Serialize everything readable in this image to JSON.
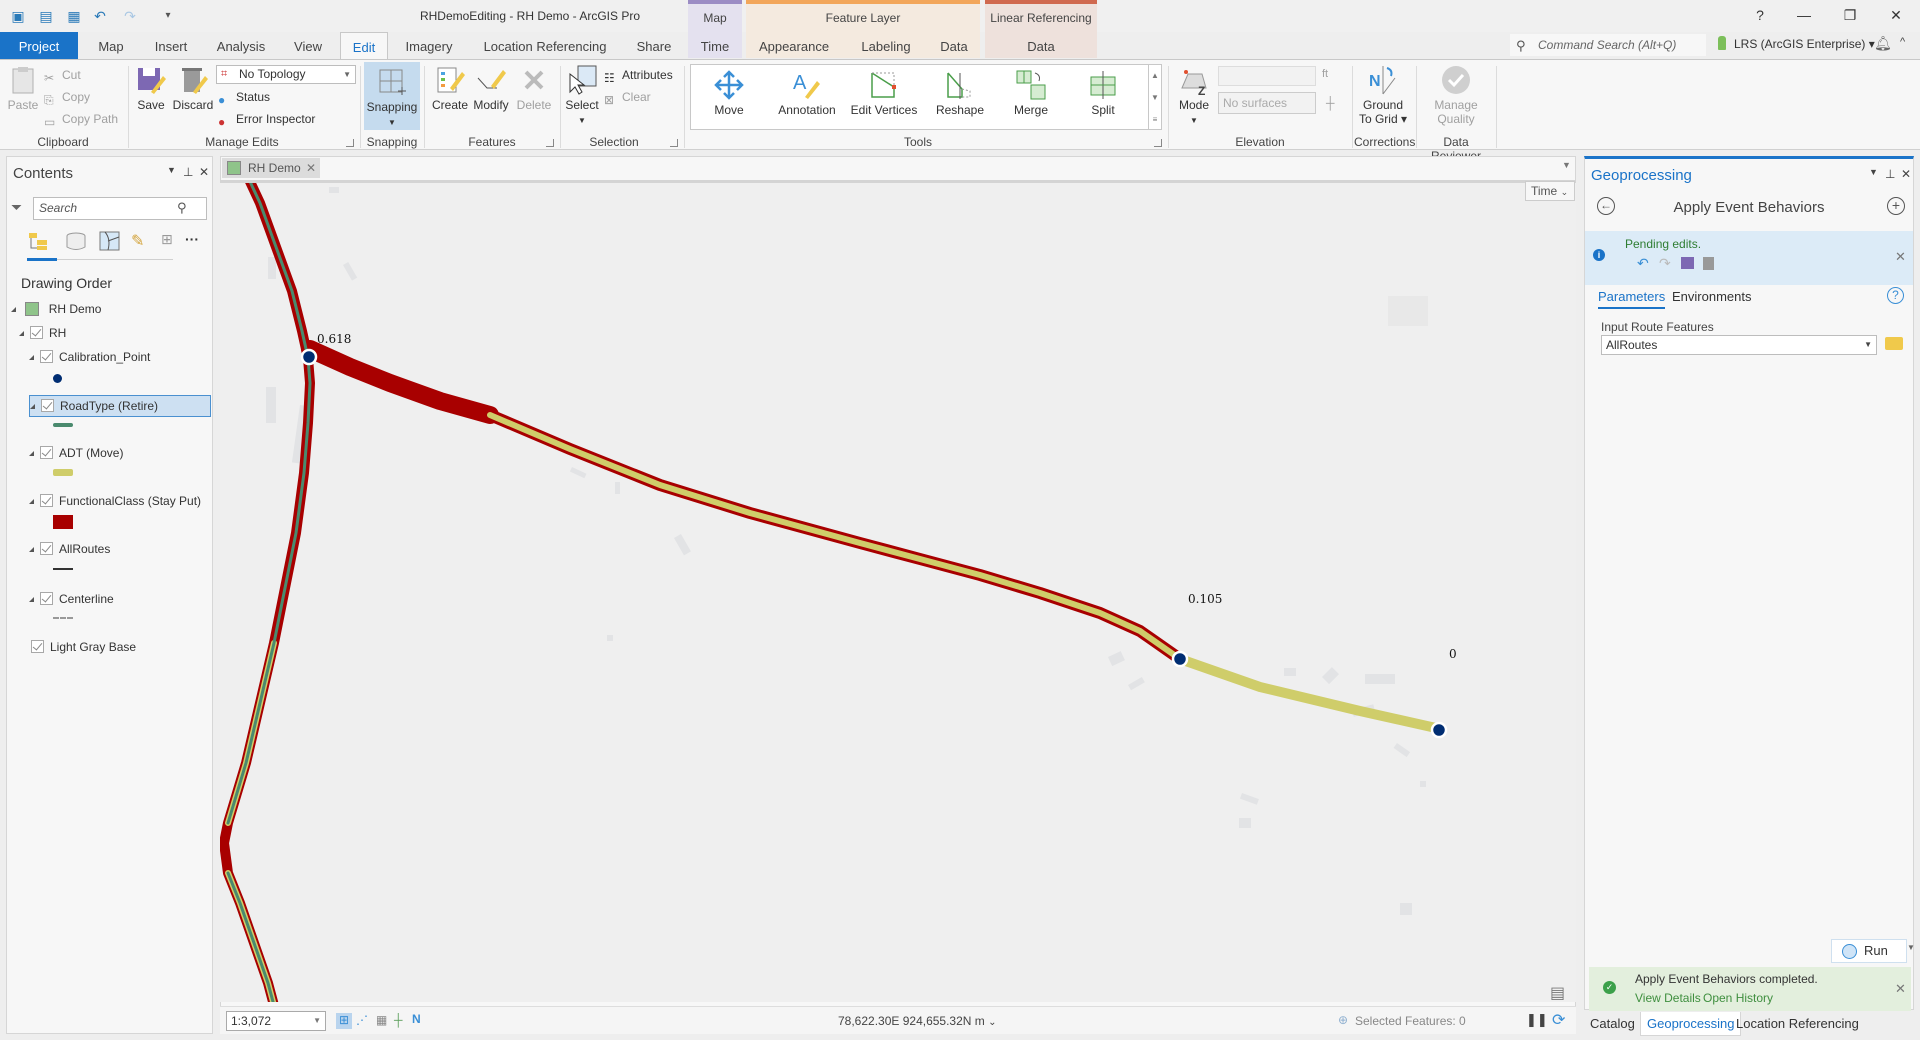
{
  "app": {
    "title": "RHDemoEditing - RH Demo - ArcGIS Pro"
  },
  "quick_access": [
    "new-project-icon",
    "open-project-icon",
    "save-project-icon",
    "undo-icon",
    "redo-icon",
    "customize-icon"
  ],
  "window_controls": {
    "help": "?",
    "minimize": "—",
    "restore": "❐",
    "close": "✕"
  },
  "contextual_tabs": [
    {
      "header": "Map",
      "color": "#9b8cc4",
      "tabs": [
        "Time"
      ]
    },
    {
      "header": "Feature Layer",
      "color": "#f2a65a",
      "tabs": [
        "Appearance",
        "Labeling",
        "Data"
      ]
    },
    {
      "header": "Linear Referencing",
      "color": "#d0694f",
      "tabs": [
        "Data"
      ]
    }
  ],
  "ribbon_tabs": [
    "Project",
    "Map",
    "Insert",
    "Analysis",
    "View",
    "Edit",
    "Imagery",
    "Location Referencing",
    "Share"
  ],
  "active_tab": "Edit",
  "command_search": {
    "placeholder": "Command Search (Alt+Q)"
  },
  "portal": {
    "label": "LRS (ArcGIS Enterprise)"
  },
  "ribbon": {
    "clipboard": {
      "label": "Clipboard",
      "paste": "Paste",
      "cut": "Cut",
      "copy": "Copy",
      "copy_path": "Copy Path"
    },
    "manage_edits": {
      "label": "Manage Edits",
      "save": "Save",
      "discard": "Discard",
      "topology": "No Topology",
      "status": "Status",
      "error_inspector": "Error Inspector"
    },
    "snapping": {
      "label": "Snapping",
      "button": "Snapping"
    },
    "features": {
      "label": "Features",
      "create": "Create",
      "modify": "Modify",
      "delete": "Delete"
    },
    "selection": {
      "label": "Selection",
      "select": "Select",
      "attributes": "Attributes",
      "clear": "Clear"
    },
    "tools": {
      "label": "Tools",
      "items": [
        "Move",
        "Annotation",
        "Edit Vertices",
        "Reshape",
        "Merge",
        "Split"
      ]
    },
    "elevation": {
      "label": "Elevation",
      "mode": "Mode",
      "unit": "ft",
      "surface_placeholder": "No surfaces"
    },
    "corrections": {
      "label": "Corrections",
      "ground_to_grid": "Ground To Grid"
    },
    "data_reviewer": {
      "label": "Data Reviewer",
      "manage_quality": "Manage Quality"
    }
  },
  "contents": {
    "title": "Contents",
    "search_placeholder": "Search",
    "section": "Drawing Order",
    "map_name": "RH Demo",
    "layers": [
      {
        "name": "RH",
        "level": 1,
        "checked": true
      },
      {
        "name": "Calibration_Point",
        "level": 2,
        "checked": true,
        "symbol": "point",
        "color": "#002d72"
      },
      {
        "name": "RoadType (Retire)",
        "level": 2,
        "checked": true,
        "symbol": "line",
        "color": "#4a8a6e",
        "selected": true
      },
      {
        "name": "ADT (Move)",
        "level": 2,
        "checked": true,
        "symbol": "thick-line",
        "color": "#cfcd6a"
      },
      {
        "name": "FunctionalClass (Stay Put)",
        "level": 2,
        "checked": true,
        "symbol": "fill",
        "color": "#a80000"
      },
      {
        "name": "AllRoutes",
        "level": 2,
        "checked": true,
        "symbol": "line",
        "color": "#333333"
      },
      {
        "name": "Centerline",
        "level": 2,
        "checked": true,
        "symbol": "dash",
        "color": "#999999"
      },
      {
        "name": "Light Gray Base",
        "level": 1,
        "checked": true
      }
    ]
  },
  "map_view": {
    "tab_label": "RH Demo",
    "time_button": "Time",
    "labels": [
      {
        "text": "0.618"
      },
      {
        "text": "0.105"
      },
      {
        "text": "0"
      }
    ],
    "scale": "1:3,072",
    "coordinates": "78,622.30E 924,655.32N m",
    "selected_features": "Selected Features: 0"
  },
  "geoprocessing": {
    "title": "Geoprocessing",
    "tool_name": "Apply Event Behaviors",
    "pending_message": "Pending edits.",
    "tabs": [
      "Parameters",
      "Environments"
    ],
    "active_tab": "Parameters",
    "parameter_label": "Input Route Features",
    "parameter_value": "AllRoutes",
    "run_label": "Run",
    "completion": {
      "message": "Apply Event Behaviors completed.",
      "view_details": "View Details",
      "open_history": "Open History"
    }
  },
  "bottom_tabs": [
    "Catalog",
    "Geoprocessing",
    "Location Referencing"
  ],
  "active_bottom_tab": "Geoprocessing",
  "colors": {
    "accent": "#1a73c8",
    "functional_class": "#a80000",
    "adt": "#cfcd6a",
    "road_type": "#4a8a6e",
    "calibration_point": "#002d72"
  }
}
